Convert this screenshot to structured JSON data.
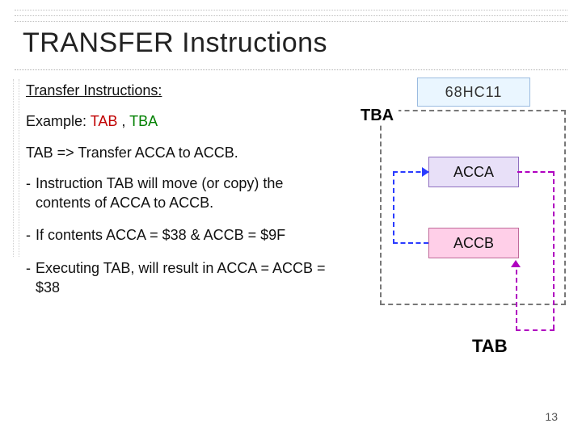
{
  "title": "TRANSFER Instructions",
  "body": {
    "subheading": "Transfer Instructions:",
    "example_prefix": "Example: ",
    "example_tab": "TAB",
    "example_sep": " , ",
    "example_tba": "TBA",
    "tab_expl": "TAB => Transfer ACCA to ACCB.",
    "bullet1": "Instruction TAB will move (or copy) the contents of ACCA to ACCB.",
    "bullet2": "If contents  ACCA = $38 & ACCB = $9F",
    "bullet3": "Executing TAB, will result in ACCA = ACCB = $38"
  },
  "diagram": {
    "header": "68HC11",
    "tba_label": "TBA",
    "acca": "ACCA",
    "accb": "ACCB",
    "tab_label": "TAB"
  },
  "page_number": "13"
}
